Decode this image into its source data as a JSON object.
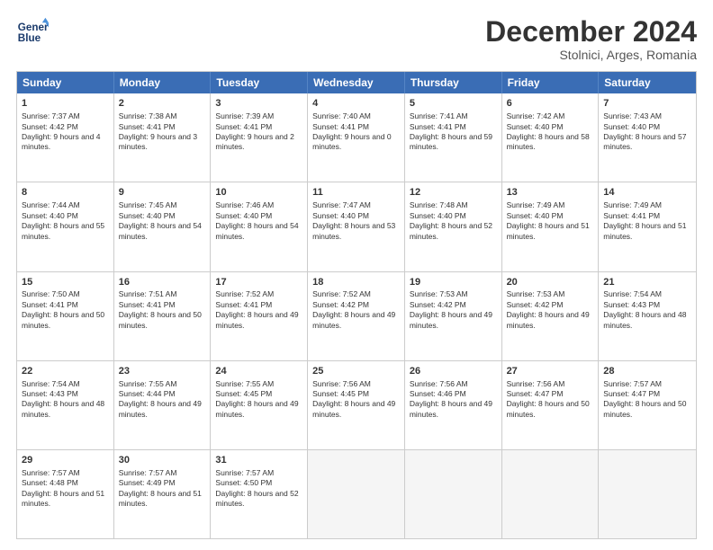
{
  "header": {
    "logo_line1": "General",
    "logo_line2": "Blue",
    "main_title": "December 2024",
    "subtitle": "Stolnici, Arges, Romania"
  },
  "days": [
    "Sunday",
    "Monday",
    "Tuesday",
    "Wednesday",
    "Thursday",
    "Friday",
    "Saturday"
  ],
  "weeks": [
    [
      {
        "day": "1",
        "sunrise": "Sunrise: 7:37 AM",
        "sunset": "Sunset: 4:42 PM",
        "daylight": "Daylight: 9 hours and 4 minutes."
      },
      {
        "day": "2",
        "sunrise": "Sunrise: 7:38 AM",
        "sunset": "Sunset: 4:41 PM",
        "daylight": "Daylight: 9 hours and 3 minutes."
      },
      {
        "day": "3",
        "sunrise": "Sunrise: 7:39 AM",
        "sunset": "Sunset: 4:41 PM",
        "daylight": "Daylight: 9 hours and 2 minutes."
      },
      {
        "day": "4",
        "sunrise": "Sunrise: 7:40 AM",
        "sunset": "Sunset: 4:41 PM",
        "daylight": "Daylight: 9 hours and 0 minutes."
      },
      {
        "day": "5",
        "sunrise": "Sunrise: 7:41 AM",
        "sunset": "Sunset: 4:41 PM",
        "daylight": "Daylight: 8 hours and 59 minutes."
      },
      {
        "day": "6",
        "sunrise": "Sunrise: 7:42 AM",
        "sunset": "Sunset: 4:40 PM",
        "daylight": "Daylight: 8 hours and 58 minutes."
      },
      {
        "day": "7",
        "sunrise": "Sunrise: 7:43 AM",
        "sunset": "Sunset: 4:40 PM",
        "daylight": "Daylight: 8 hours and 57 minutes."
      }
    ],
    [
      {
        "day": "8",
        "sunrise": "Sunrise: 7:44 AM",
        "sunset": "Sunset: 4:40 PM",
        "daylight": "Daylight: 8 hours and 55 minutes."
      },
      {
        "day": "9",
        "sunrise": "Sunrise: 7:45 AM",
        "sunset": "Sunset: 4:40 PM",
        "daylight": "Daylight: 8 hours and 54 minutes."
      },
      {
        "day": "10",
        "sunrise": "Sunrise: 7:46 AM",
        "sunset": "Sunset: 4:40 PM",
        "daylight": "Daylight: 8 hours and 54 minutes."
      },
      {
        "day": "11",
        "sunrise": "Sunrise: 7:47 AM",
        "sunset": "Sunset: 4:40 PM",
        "daylight": "Daylight: 8 hours and 53 minutes."
      },
      {
        "day": "12",
        "sunrise": "Sunrise: 7:48 AM",
        "sunset": "Sunset: 4:40 PM",
        "daylight": "Daylight: 8 hours and 52 minutes."
      },
      {
        "day": "13",
        "sunrise": "Sunrise: 7:49 AM",
        "sunset": "Sunset: 4:40 PM",
        "daylight": "Daylight: 8 hours and 51 minutes."
      },
      {
        "day": "14",
        "sunrise": "Sunrise: 7:49 AM",
        "sunset": "Sunset: 4:41 PM",
        "daylight": "Daylight: 8 hours and 51 minutes."
      }
    ],
    [
      {
        "day": "15",
        "sunrise": "Sunrise: 7:50 AM",
        "sunset": "Sunset: 4:41 PM",
        "daylight": "Daylight: 8 hours and 50 minutes."
      },
      {
        "day": "16",
        "sunrise": "Sunrise: 7:51 AM",
        "sunset": "Sunset: 4:41 PM",
        "daylight": "Daylight: 8 hours and 50 minutes."
      },
      {
        "day": "17",
        "sunrise": "Sunrise: 7:52 AM",
        "sunset": "Sunset: 4:41 PM",
        "daylight": "Daylight: 8 hours and 49 minutes."
      },
      {
        "day": "18",
        "sunrise": "Sunrise: 7:52 AM",
        "sunset": "Sunset: 4:42 PM",
        "daylight": "Daylight: 8 hours and 49 minutes."
      },
      {
        "day": "19",
        "sunrise": "Sunrise: 7:53 AM",
        "sunset": "Sunset: 4:42 PM",
        "daylight": "Daylight: 8 hours and 49 minutes."
      },
      {
        "day": "20",
        "sunrise": "Sunrise: 7:53 AM",
        "sunset": "Sunset: 4:42 PM",
        "daylight": "Daylight: 8 hours and 49 minutes."
      },
      {
        "day": "21",
        "sunrise": "Sunrise: 7:54 AM",
        "sunset": "Sunset: 4:43 PM",
        "daylight": "Daylight: 8 hours and 48 minutes."
      }
    ],
    [
      {
        "day": "22",
        "sunrise": "Sunrise: 7:54 AM",
        "sunset": "Sunset: 4:43 PM",
        "daylight": "Daylight: 8 hours and 48 minutes."
      },
      {
        "day": "23",
        "sunrise": "Sunrise: 7:55 AM",
        "sunset": "Sunset: 4:44 PM",
        "daylight": "Daylight: 8 hours and 49 minutes."
      },
      {
        "day": "24",
        "sunrise": "Sunrise: 7:55 AM",
        "sunset": "Sunset: 4:45 PM",
        "daylight": "Daylight: 8 hours and 49 minutes."
      },
      {
        "day": "25",
        "sunrise": "Sunrise: 7:56 AM",
        "sunset": "Sunset: 4:45 PM",
        "daylight": "Daylight: 8 hours and 49 minutes."
      },
      {
        "day": "26",
        "sunrise": "Sunrise: 7:56 AM",
        "sunset": "Sunset: 4:46 PM",
        "daylight": "Daylight: 8 hours and 49 minutes."
      },
      {
        "day": "27",
        "sunrise": "Sunrise: 7:56 AM",
        "sunset": "Sunset: 4:47 PM",
        "daylight": "Daylight: 8 hours and 50 minutes."
      },
      {
        "day": "28",
        "sunrise": "Sunrise: 7:57 AM",
        "sunset": "Sunset: 4:47 PM",
        "daylight": "Daylight: 8 hours and 50 minutes."
      }
    ],
    [
      {
        "day": "29",
        "sunrise": "Sunrise: 7:57 AM",
        "sunset": "Sunset: 4:48 PM",
        "daylight": "Daylight: 8 hours and 51 minutes."
      },
      {
        "day": "30",
        "sunrise": "Sunrise: 7:57 AM",
        "sunset": "Sunset: 4:49 PM",
        "daylight": "Daylight: 8 hours and 51 minutes."
      },
      {
        "day": "31",
        "sunrise": "Sunrise: 7:57 AM",
        "sunset": "Sunset: 4:50 PM",
        "daylight": "Daylight: 8 hours and 52 minutes."
      },
      null,
      null,
      null,
      null
    ]
  ]
}
